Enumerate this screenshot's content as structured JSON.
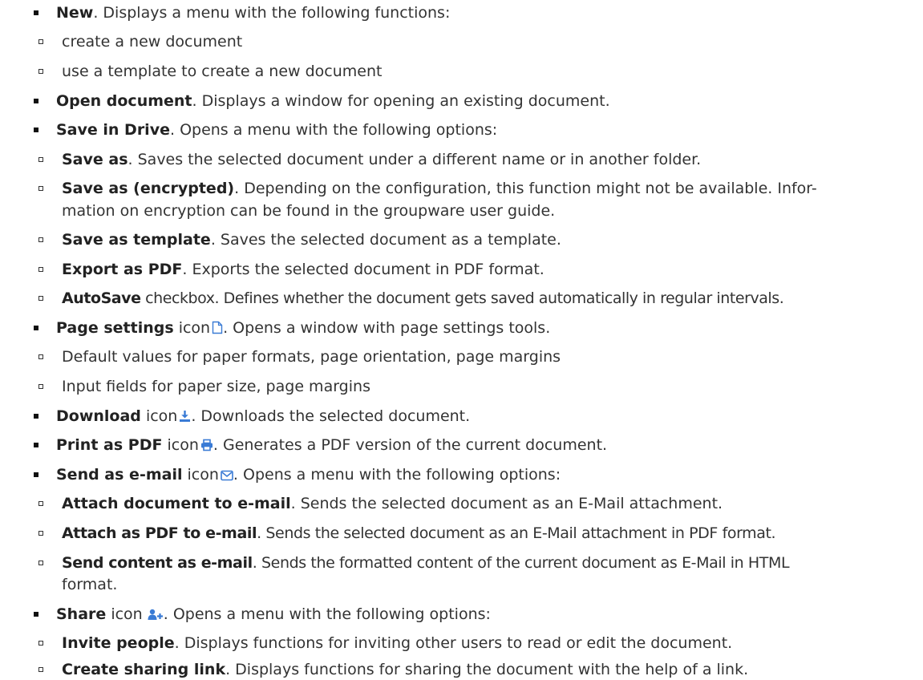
{
  "items": [
    {
      "level": 1,
      "term": "New",
      "text": ". Displays a menu with the following functions:"
    },
    {
      "level": 2,
      "term": "",
      "text": "create a new document"
    },
    {
      "level": 2,
      "term": "",
      "text": "use a template to create a new document"
    },
    {
      "level": 1,
      "term": "Open document",
      "text": ". Displays a window for opening an existing document."
    },
    {
      "level": 1,
      "term": "Save in Drive",
      "text": ". Opens a menu with the following options:"
    },
    {
      "level": 2,
      "term": "Save as",
      "text": ". Saves the selected document under a different name or in another folder."
    },
    {
      "level": 2,
      "term": "Save as (encrypted)",
      "text": ". Depending on the configuration, this function might not be available. Infor-",
      "text2": "mation on encryption can be found in the groupware user guide."
    },
    {
      "level": 2,
      "term": "Save as template",
      "text": ". Saves the selected document as a template."
    },
    {
      "level": 2,
      "term": "Export as PDF",
      "text": ". Exports the selected document in PDF format."
    },
    {
      "level": 2,
      "term": "AutoSave",
      "text": " checkbox. Defines whether the document gets saved automatically in regular intervals."
    },
    {
      "level": 1,
      "term": "Page settings",
      "mid": " icon",
      "icon": "page-icon",
      "text": ". Opens a window with page settings tools."
    },
    {
      "level": 2,
      "term": "",
      "text": "Default values for paper formats, page orientation, page margins"
    },
    {
      "level": 2,
      "term": "",
      "text": "Input fields for paper size, page margins"
    },
    {
      "level": 1,
      "term": "Download",
      "mid": " icon",
      "icon": "download-icon",
      "text": ". Downloads the selected document."
    },
    {
      "level": 1,
      "term": "Print as PDF",
      "mid": " icon",
      "icon": "print-icon",
      "text": ". Generates a PDF version of the current document."
    },
    {
      "level": 1,
      "term": "Send as e-mail",
      "mid": " icon",
      "icon": "envelope-icon",
      "text": ". Opens a menu with the following options:"
    },
    {
      "level": 2,
      "term": "Attach document to e-mail",
      "text": ". Sends the selected document as an E-Mail attachment."
    },
    {
      "level": 2,
      "term": "Attach as PDF to e-mail",
      "text": ". Sends the selected document as an E-Mail attachment in PDF format."
    },
    {
      "level": 2,
      "term": "Send content as e-mail",
      "text": ". Sends the formatted content of the current document as E-Mail in HTML",
      "text2": "format."
    },
    {
      "level": 1,
      "term": "Share",
      "mid": " icon",
      "icon": "share-icon",
      "text": ". Opens a menu with the following options:"
    },
    {
      "level": 2,
      "term": "Invite people",
      "text": ". Displays functions for inviting other users to read or edit the document."
    },
    {
      "level": 2,
      "term": "Create sharing link",
      "text": ". Displays functions for sharing the document with the help of a link."
    }
  ],
  "colors": {
    "text": "#333333",
    "icon": "#3a7bd5"
  }
}
